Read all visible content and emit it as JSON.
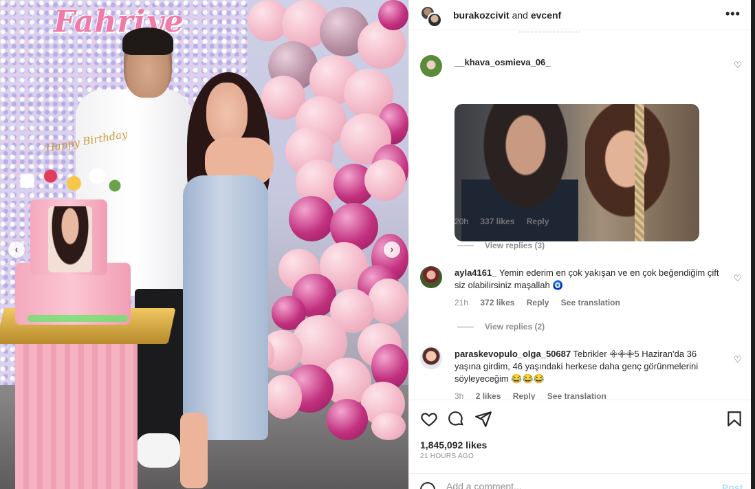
{
  "photo": {
    "sign_text": "Fahriye",
    "cake_topper_text": "Happy Birthday"
  },
  "post_header": {
    "user1": "burakozcivit",
    "joiner": "and",
    "user2": "evcenf",
    "more_icon": "more-horizontal-icon"
  },
  "comments": [
    {
      "username": "__khava_osmieva_06_",
      "text": "",
      "has_gif": true,
      "time": "20h",
      "likes": "337 likes",
      "reply": "Reply",
      "see_translation": "",
      "view_replies": "View replies (3)"
    },
    {
      "username": "ayla4161_",
      "text": "Yemin ederim en çok yakışan ve en çok beğendiğim çift siz olabilirsiniz maşallah",
      "emoji": "🧿",
      "time": "21h",
      "likes": "372 likes",
      "reply": "Reply",
      "see_translation": "See translation",
      "view_replies": "View replies (2)"
    },
    {
      "username": "paraskevopulo_olga_50687",
      "text": "Tebrikler 𖧷𖧷𖧷5 Haziran'da 36 yaşına girdim, 46 yaşındaki herkese daha genç görünmelerini söyleyeceğim",
      "emoji": "😂😂😂",
      "time": "3h",
      "likes": "2 likes",
      "reply": "Reply",
      "see_translation": "See translation"
    }
  ],
  "actions": {
    "like_icon": "heart-icon",
    "comment_icon": "comment-icon",
    "share_icon": "send-icon",
    "save_icon": "bookmark-icon",
    "likes_count": "1,845,092 likes",
    "time_ago": "21 HOURS AGO"
  },
  "add_comment": {
    "placeholder": "Add a comment...",
    "post_label": "Post"
  },
  "colors": {
    "link_blue_disabled": "#b2dffc",
    "text_primary": "#262626",
    "text_secondary": "#8e8e8e"
  }
}
